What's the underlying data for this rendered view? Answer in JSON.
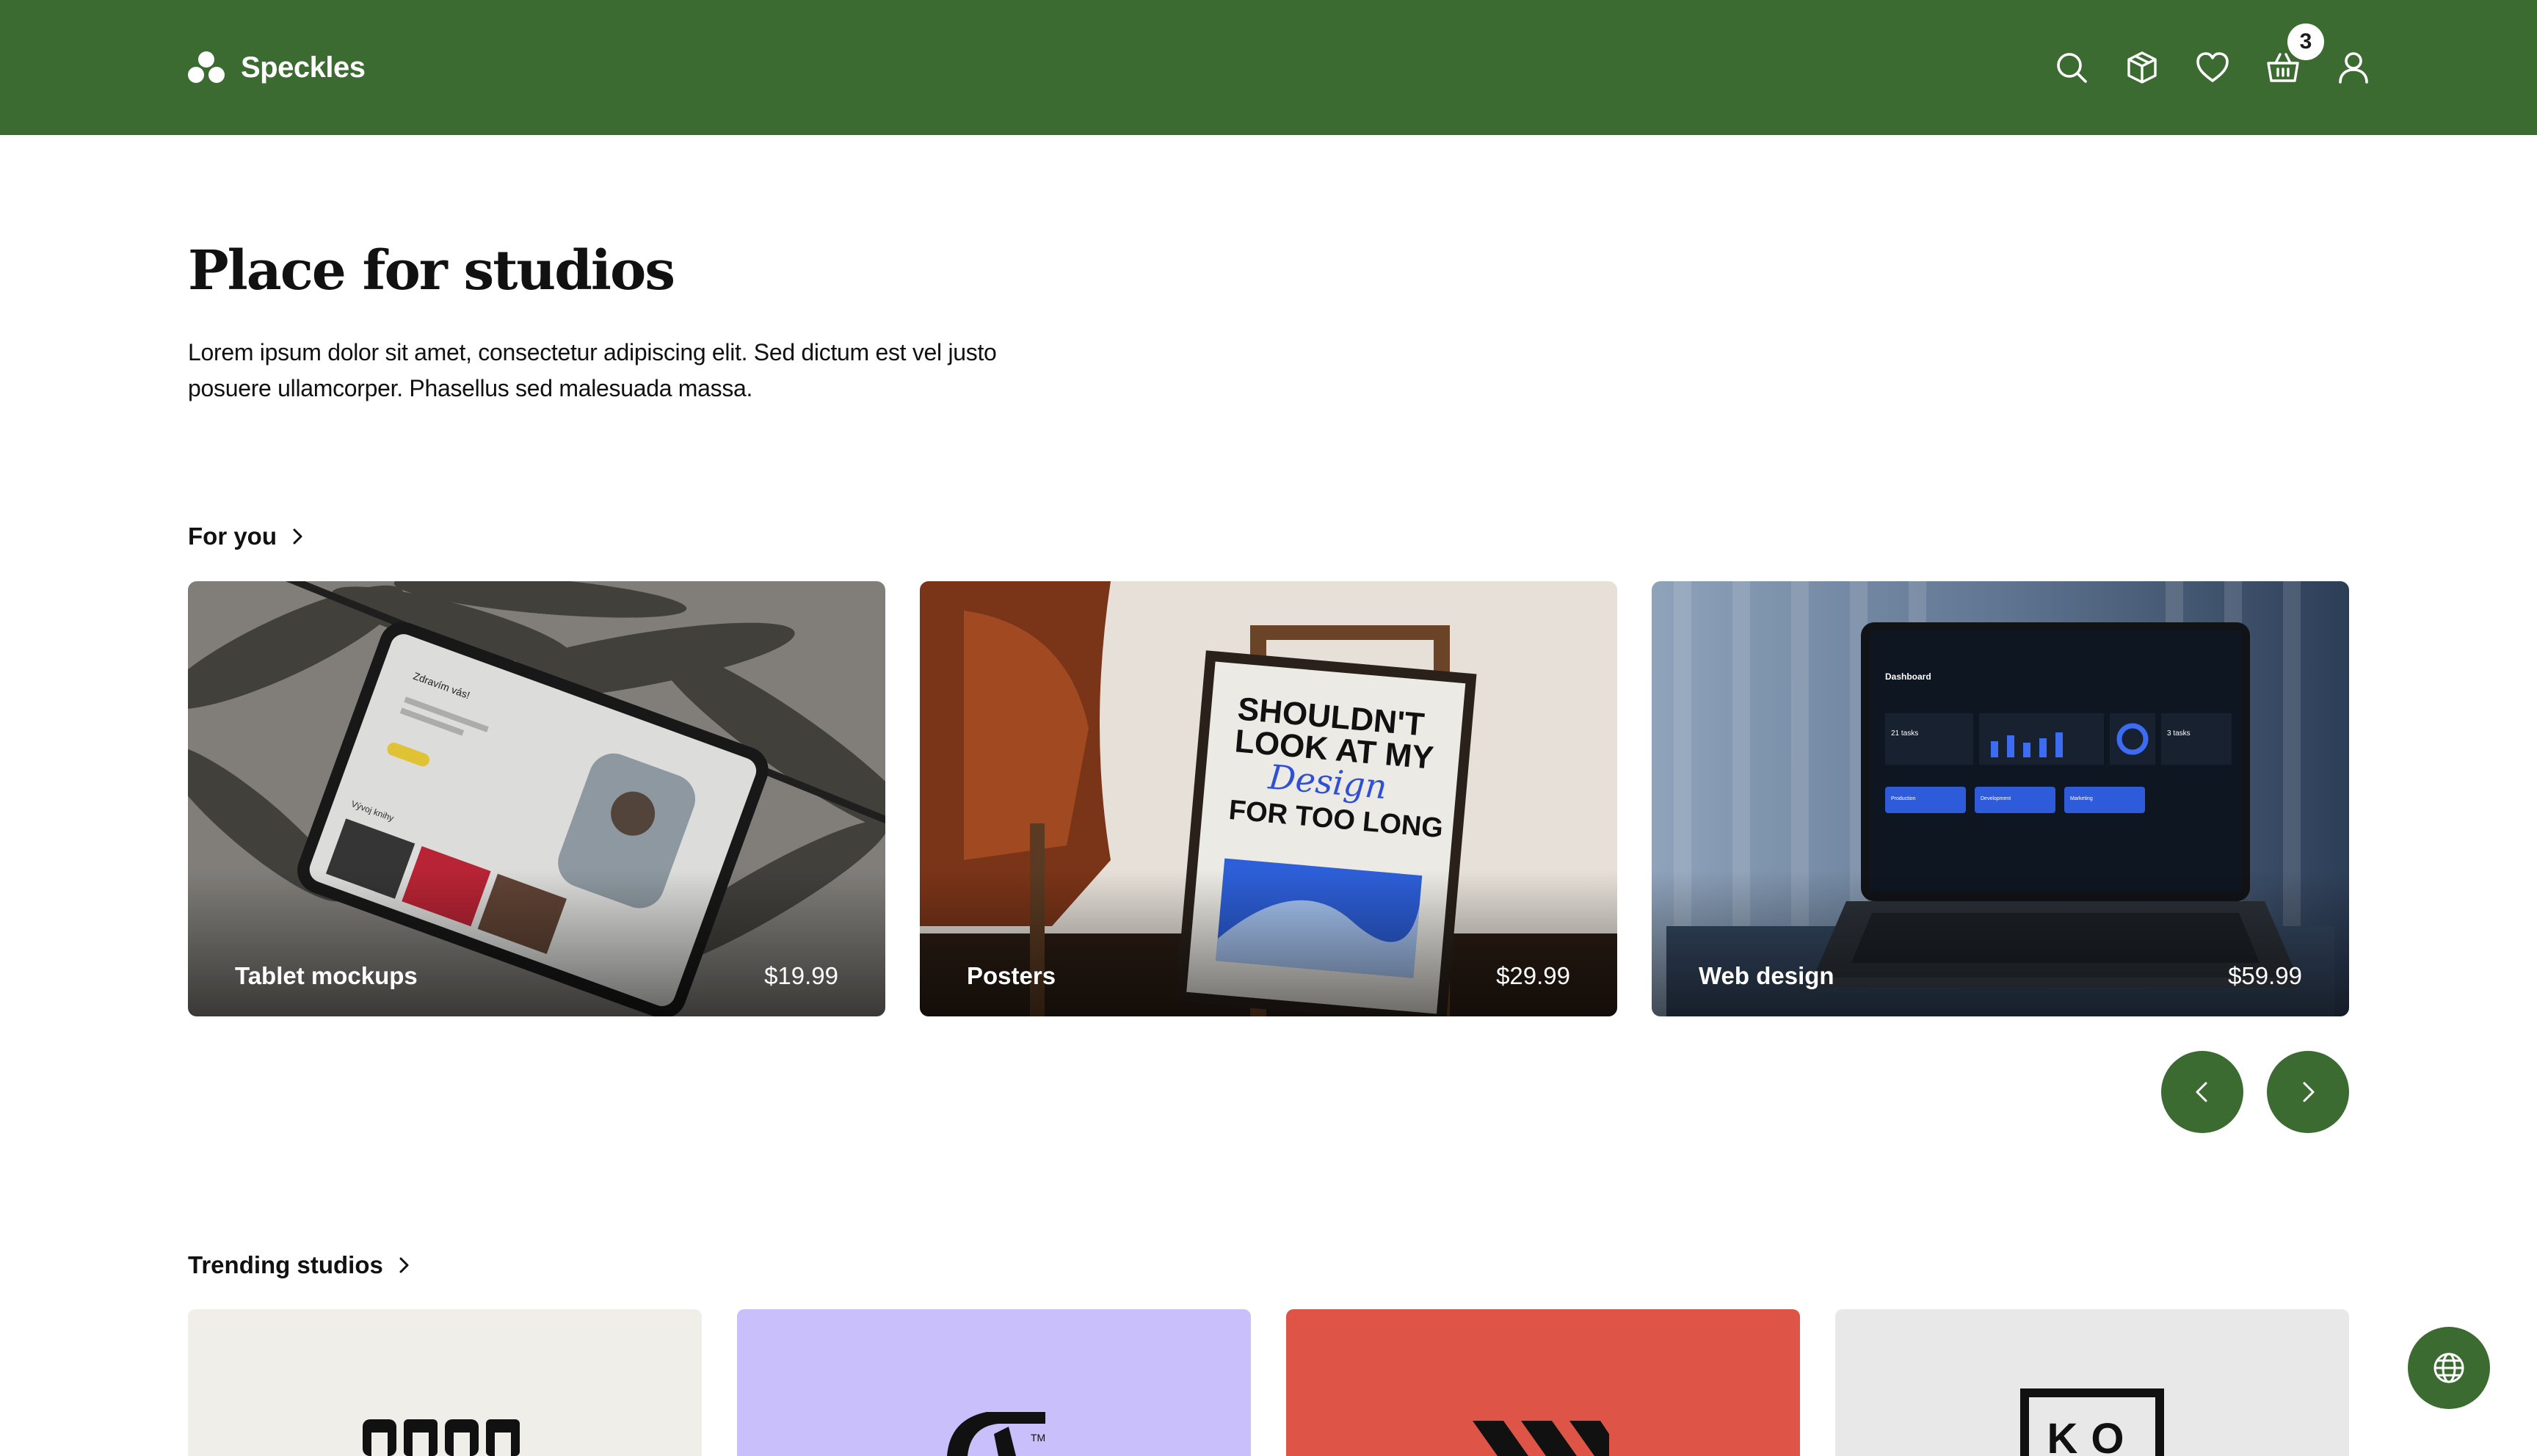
{
  "header": {
    "brand": "Speckles",
    "icons": [
      "search-icon",
      "package-icon",
      "heart-icon",
      "basket-icon",
      "user-icon"
    ],
    "cart_count": "3",
    "background_color": "#3b6b30"
  },
  "hero": {
    "title": "Place for studios",
    "text": "Lorem ipsum dolor sit amet, consectetur adipiscing elit. Sed dictum est vel justo posuere ullamcorper. Phasellus sed malesuada massa."
  },
  "for_you": {
    "heading": "For you",
    "cards": [
      {
        "label": "Tablet mockups",
        "price": "$19.99"
      },
      {
        "label": "Posters",
        "price": "$29.99"
      },
      {
        "label": "Web design",
        "price": "$59.99"
      }
    ],
    "poster_text": [
      "SHOULDN'T",
      "LOOK AT MY",
      "Design",
      "FOR TOO LONG"
    ],
    "dashboard_text": {
      "title": "Dashboard",
      "stat": "21 tasks",
      "stat2": "3 tasks",
      "chips": [
        "Production",
        "Development",
        "Marketing"
      ]
    },
    "tablet_text": {
      "greeting": "Zdravím vás!",
      "gallery": "Vývoj knihy"
    }
  },
  "carousel": {
    "prev_icon": "chevron-left-icon",
    "next_icon": "chevron-right-icon"
  },
  "trending": {
    "heading": "Trending studios",
    "studios": [
      {
        "bg": "#efeee9"
      },
      {
        "bg": "#c8bffb"
      },
      {
        "bg": "#de5547"
      },
      {
        "bg": "#e8e8e8",
        "logo_text": "KO"
      }
    ]
  },
  "language_button": {
    "icon": "globe-icon"
  }
}
